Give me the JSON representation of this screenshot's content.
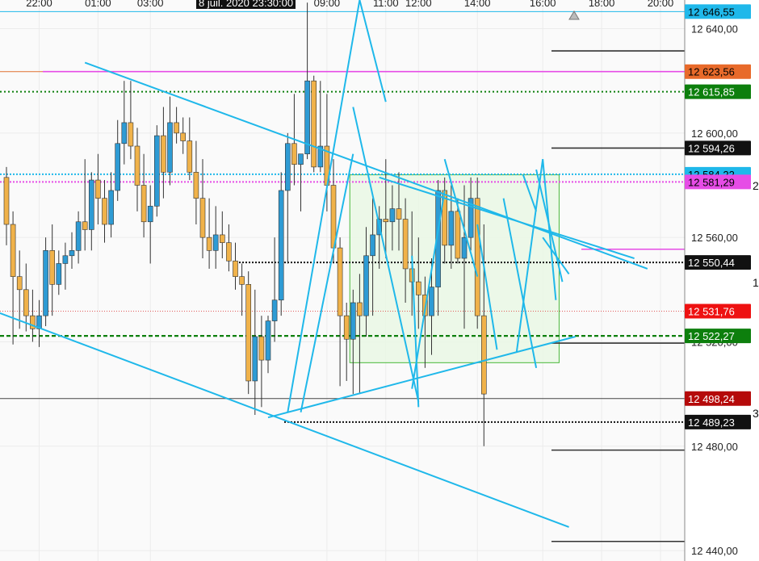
{
  "chart_data": {
    "type": "candlestick",
    "colors": {
      "up": "#2e9bd4",
      "down": "#f0b24a",
      "cyan": "#1fb8ea",
      "magenta": "#e64ce6",
      "green": "#0d7f0d",
      "orange": "#e07030",
      "red": "#ee1111",
      "darkred": "#b50a0a",
      "black": "#111111"
    },
    "y_range": [
      12436,
      12651
    ],
    "x_ticks": [
      {
        "label": "22:00",
        "bar": 5
      },
      {
        "label": "01:00",
        "bar": 14
      },
      {
        "label": "03:00",
        "bar": 22
      },
      {
        "label": "09:00",
        "bar": 49
      },
      {
        "label": "11:00",
        "bar": 58
      },
      {
        "label": "12:00",
        "bar": 63
      },
      {
        "label": "14:00",
        "bar": 72
      },
      {
        "label": "16:00",
        "bar": 82
      },
      {
        "label": "18:00",
        "bar": 91
      },
      {
        "label": "20:00",
        "bar": 100
      }
    ],
    "date_label": "8 juil. 2020 23:30:00",
    "y_ticks": [
      "12 640,00",
      "12 600,00",
      "12 560,00",
      "12 520,00",
      "12 480,00",
      "12 440,00"
    ],
    "y_tick_values": [
      12640,
      12600,
      12560,
      12520,
      12480,
      12440
    ],
    "price_tags": [
      {
        "value": 12646.55,
        "label": "12 646,55",
        "bg": "#1fb8ea",
        "fg": "#000000"
      },
      {
        "value": 12623.56,
        "label": "12 623,56",
        "bg": "#e86a2a",
        "fg": "#000000"
      },
      {
        "value": 12615.85,
        "label": "12 615,85",
        "bg": "#0d7f0d",
        "fg": "#ffffff"
      },
      {
        "value": 12594.26,
        "label": "12 594,26",
        "bg": "#111111",
        "fg": "#ffffff"
      },
      {
        "value": 12584.22,
        "label": "12 584,22",
        "bg": "#1fb8ea",
        "fg": "#000000"
      },
      {
        "value": 12581.29,
        "label": "12 581,29",
        "bg": "#e64ce6",
        "fg": "#000000"
      },
      {
        "value": 12550.44,
        "label": "12 550,44",
        "bg": "#111111",
        "fg": "#ffffff"
      },
      {
        "value": 12531.76,
        "label": "12 531,76",
        "bg": "#ee1111",
        "fg": "#ffffff"
      },
      {
        "value": 12522.27,
        "label": "12 522,27",
        "bg": "#0d7f0d",
        "fg": "#ffffff"
      },
      {
        "value": 12498.24,
        "label": "12 498,24",
        "bg": "#b50a0a",
        "fg": "#ffffff"
      },
      {
        "value": 12489.23,
        "label": "12 489,23",
        "bg": "#111111",
        "fg": "#ffffff"
      }
    ],
    "edge_digits": [
      "2",
      "1",
      "3"
    ],
    "candles": [
      [
        12583,
        12587,
        12557,
        12565
      ],
      [
        12565,
        12570,
        12519,
        12545
      ],
      [
        12545,
        12555,
        12525,
        12540
      ],
      [
        12540,
        12550,
        12524,
        12530
      ],
      [
        12530,
        12540,
        12520,
        12525
      ],
      [
        12525,
        12536,
        12518,
        12530
      ],
      [
        12530,
        12560,
        12526,
        12555
      ],
      [
        12555,
        12565,
        12530,
        12542
      ],
      [
        12542,
        12555,
        12538,
        12550
      ],
      [
        12550,
        12558,
        12540,
        12553
      ],
      [
        12553,
        12562,
        12548,
        12555
      ],
      [
        12555,
        12570,
        12550,
        12566
      ],
      [
        12566,
        12590,
        12555,
        12563
      ],
      [
        12563,
        12585,
        12555,
        12582
      ],
      [
        12582,
        12592,
        12565,
        12575
      ],
      [
        12575,
        12582,
        12558,
        12565
      ],
      [
        12565,
        12585,
        12560,
        12578
      ],
      [
        12578,
        12605,
        12574,
        12596
      ],
      [
        12596,
        12620,
        12588,
        12604
      ],
      [
        12604,
        12620,
        12590,
        12595
      ],
      [
        12595,
        12602,
        12570,
        12580
      ],
      [
        12580,
        12592,
        12560,
        12566
      ],
      [
        12566,
        12580,
        12550,
        12572
      ],
      [
        12572,
        12603,
        12568,
        12599
      ],
      [
        12599,
        12610,
        12575,
        12585
      ],
      [
        12585,
        12614,
        12580,
        12604
      ],
      [
        12604,
        12610,
        12596,
        12600
      ],
      [
        12600,
        12606,
        12592,
        12597
      ],
      [
        12597,
        12606,
        12582,
        12585
      ],
      [
        12585,
        12597,
        12565,
        12575
      ],
      [
        12575,
        12590,
        12552,
        12560
      ],
      [
        12560,
        12575,
        12548,
        12555
      ],
      [
        12555,
        12572,
        12548,
        12561
      ],
      [
        12561,
        12570,
        12552,
        12558
      ],
      [
        12558,
        12565,
        12547,
        12551
      ],
      [
        12551,
        12558,
        12540,
        12545
      ],
      [
        12545,
        12550,
        12530,
        12542
      ],
      [
        12542,
        12547,
        12500,
        12505
      ],
      [
        12505,
        12540,
        12492,
        12522
      ],
      [
        12522,
        12530,
        12495,
        12513
      ],
      [
        12513,
        12530,
        12508,
        12528
      ],
      [
        12528,
        12560,
        12520,
        12536
      ],
      [
        12536,
        12585,
        12530,
        12578
      ],
      [
        12578,
        12600,
        12550,
        12596
      ],
      [
        12596,
        12615,
        12580,
        12588
      ],
      [
        12588,
        12590,
        12570,
        12592
      ],
      [
        12592,
        12650,
        12590,
        12620
      ],
      [
        12620,
        12622,
        12585,
        12587
      ],
      [
        12587,
        12620,
        12585,
        12595
      ],
      [
        12595,
        12615,
        12570,
        12580
      ],
      [
        12580,
        12590,
        12550,
        12556
      ],
      [
        12556,
        12560,
        12503,
        12530
      ],
      [
        12530,
        12535,
        12505,
        12521
      ],
      [
        12521,
        12540,
        12500,
        12535
      ],
      [
        12535,
        12546,
        12500,
        12530
      ],
      [
        12530,
        12564,
        12522,
        12553
      ],
      [
        12553,
        12575,
        12530,
        12561
      ],
      [
        12561,
        12572,
        12548,
        12567
      ],
      [
        12567,
        12590,
        12552,
        12566
      ],
      [
        12566,
        12580,
        12555,
        12571
      ],
      [
        12571,
        12585,
        12555,
        12567
      ],
      [
        12567,
        12575,
        12535,
        12548
      ],
      [
        12548,
        12570,
        12530,
        12543
      ],
      [
        12543,
        12560,
        12525,
        12538
      ],
      [
        12538,
        12545,
        12510,
        12530
      ],
      [
        12530,
        12552,
        12515,
        12541
      ],
      [
        12541,
        12582,
        12530,
        12578
      ],
      [
        12578,
        12583,
        12550,
        12557
      ],
      [
        12557,
        12580,
        12548,
        12570
      ],
      [
        12570,
        12575,
        12550,
        12552
      ],
      [
        12552,
        12580,
        12525,
        12560
      ],
      [
        12560,
        12583,
        12555,
        12575
      ],
      [
        12575,
        12583,
        12525,
        12530
      ],
      [
        12530,
        12565,
        12480,
        12500
      ]
    ],
    "bar_count": 104
  }
}
